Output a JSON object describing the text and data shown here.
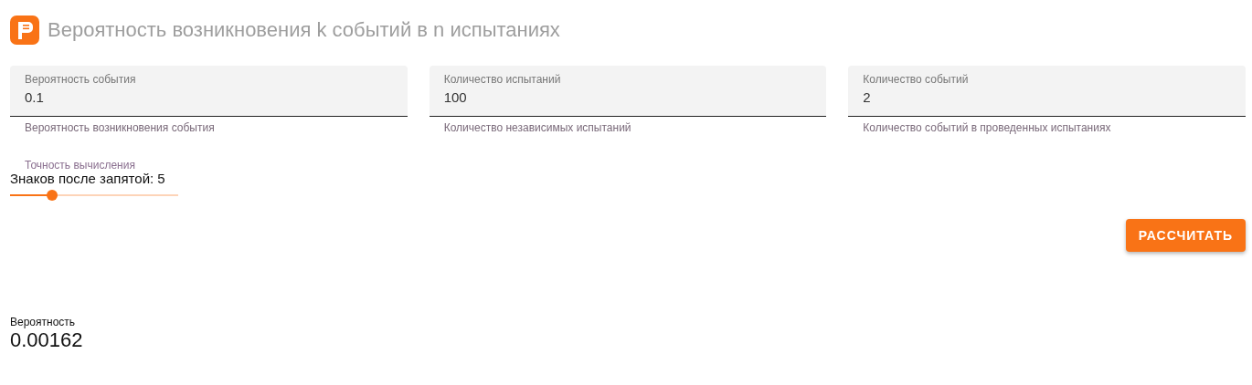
{
  "header": {
    "title": "Вероятность возникновения k событий в n испытаниях"
  },
  "fields": [
    {
      "label": "Вероятность события",
      "value": "0.1",
      "hint": "Вероятность возникновения события"
    },
    {
      "label": "Количество испытаний",
      "value": "100",
      "hint": "Количество независимых испытаний"
    },
    {
      "label": "Количество событий",
      "value": "2",
      "hint": "Количество событий в проведенных испытаниях"
    }
  ],
  "precision": {
    "caption": "Точность вычисления",
    "label": "Знаков после запятой: 5",
    "level": 0.25
  },
  "button": "РАССЧИТАТЬ",
  "result": {
    "label": "Вероятность",
    "value": "0.00162"
  }
}
